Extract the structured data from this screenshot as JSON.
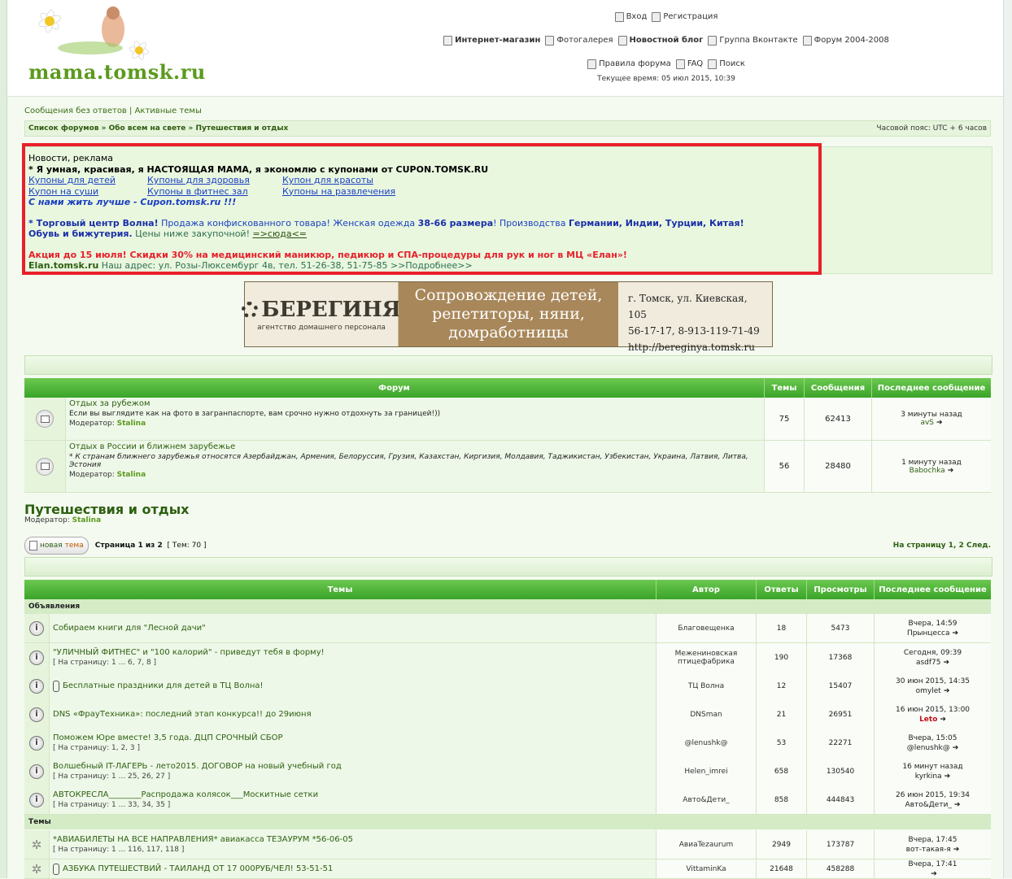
{
  "site": {
    "logo_text": "mama.tomsk.ru"
  },
  "header": {
    "login": "Вход",
    "register": "Регистрация",
    "links": [
      "Интернет-магазин",
      "Фотогалерея",
      "Новостной блог",
      "Группа Вконтакте",
      "Форум 2004-2008"
    ],
    "links2": [
      "Правила форума",
      "FAQ",
      "Поиск"
    ],
    "current_time": "Текущее время: 05 июл 2015, 10:39"
  },
  "toplinks": {
    "unanswered": "Сообщения без ответов",
    "sep": "|",
    "active": "Активные темы"
  },
  "breadcrumb": {
    "text": "Список форумов » Обо всем на свете » Путешествия и отдых",
    "timezone": "Часовой пояс: UTC + 6 часов"
  },
  "ad": {
    "title": "Новости, реклама",
    "line1": "* Я умная, красивая, я НАСТОЯЩАЯ МАМА, я экономлю с купонами от CUPON.TOMSK.RU",
    "links_row1": [
      "Купоны для детей",
      "Купоны для здоровья",
      "Купон для красоты"
    ],
    "links_row2": [
      "Купон на суши",
      "Купоны в фитнес зал",
      "Купоны на развлечения"
    ],
    "slogan": "С нами жить лучше - Cupon.tomsk.ru !!!",
    "volna_a": "* ",
    "volna_b": "Торговый центр Волна!",
    "volna_c": " Продажа конфискованного товара! Женская одежда ",
    "volna_d": "38-66 размера",
    "volna_e": "! Производства ",
    "volna_f": "Германии, Индии, Турции, Китая!",
    "volna2_a": "Обувь и бижутерия.",
    "volna2_b": " Цены ниже закупочной! ",
    "volna2_c": "=>сюда<=",
    "promo": "Акция до 15 июля! Скидки 30% на медицинский маникюр, педикюр и СПА-процедуры для рук и ног в МЦ «Елан»!",
    "elan_a": "Elan.tomsk.ru",
    "elan_b": " Наш адрес: ул. Розы-Люксембург 4в, тел. 51-26-38, 51-75-85 >>Подробнее>>"
  },
  "banner": {
    "brand": "БЕРЕГИНЯ",
    "sub": "агентство домашнего персонала",
    "mid": [
      "Сопровождение детей,",
      "репетиторы, няни,",
      "домработницы"
    ],
    "addr": "г. Томск, ул. Киевская, 105",
    "phones": "56-17-17, 8-913-119-71-49",
    "url": "http://bereginya.tomsk.ru"
  },
  "forums_table": {
    "headers": {
      "forum": "Форум",
      "topics": "Темы",
      "posts": "Сообщения",
      "last": "Последнее сообщение"
    },
    "rows": [
      {
        "title": "Отдых за рубежом",
        "desc": "Если вы выглядите как на фото в загранпаспорте, вам срочно нужно отдохнуть за границей!))",
        "mod_label": "Модератор:",
        "mod": "Stalina",
        "topics": "75",
        "posts": "62413",
        "last_time": "3 минуты назад",
        "last_user": "avS"
      },
      {
        "title": "Отдых в России и ближнем зарубежье",
        "desc": "* К странам ближнего зарубежья относятся Азербайджан, Армения, Белоруссия, Грузия, Казахстан, Киргизия, Молдавия, Таджикистан, Узбекистан, Украина, Латвия, Литва, Эстония",
        "mod_label": "Модератор:",
        "mod": "Stalina",
        "topics": "56",
        "posts": "28480",
        "last_time": "1 минуту назад",
        "last_user": "Babochka"
      }
    ]
  },
  "section": {
    "title": "Путешествия и отдых",
    "mod_label": "Модератор:",
    "mod": "Stalina"
  },
  "pager": {
    "new_topic_a": "новая",
    "new_topic_b": "тема",
    "page_a": "Страница ",
    "page_cur": "1",
    "page_b": " из ",
    "page_total": "2",
    "topics_count": "[ Тем: 70 ]",
    "goto": "На страницу 1, 2  След."
  },
  "topics_table": {
    "headers": {
      "topics": "Темы",
      "author": "Автор",
      "replies": "Ответы",
      "views": "Просмотры",
      "last": "Последнее сообщение"
    },
    "announce_label": "Объявления",
    "topics_label": "Темы",
    "announcements": [
      {
        "title": "Собираем книги для \"Лесной дачи\"",
        "pages": "",
        "author": "Благовещенка",
        "replies": "18",
        "views": "5473",
        "last_time": "Вчера, 14:59",
        "last_user": "Прынцесса",
        "clip": false
      },
      {
        "title": "\"УЛИЧНЫЙ ФИТНЕС\" и \"100 калорий\" - приведут тебя в форму!",
        "pages": "[ На страницу: 1 ... 6, 7, 8 ]",
        "author": "Межениновская птицефабрика",
        "replies": "190",
        "views": "17368",
        "last_time": "Сегодня, 09:39",
        "last_user": "asdf75",
        "clip": false
      },
      {
        "title": "Бесплатные праздники для детей в ТЦ Волна!",
        "pages": "",
        "author": "ТЦ Волна",
        "replies": "12",
        "views": "15407",
        "last_time": "30 июн 2015, 14:35",
        "last_user": "omylet",
        "clip": true
      },
      {
        "title": "DNS «ФрауТехника»: последний этап конкурса!! до 29июня",
        "pages": "",
        "author": "DNSman",
        "replies": "21",
        "views": "26951",
        "last_time": "16 июн 2015, 13:00",
        "last_user": "Leto",
        "clip": false,
        "red_user": true
      },
      {
        "title": "Поможем Юре вместе! 3,5 года. ДЦП СРОЧНЫЙ СБОР",
        "pages": "[ На страницу: 1, 2, 3 ]",
        "author": "@lenushk@",
        "replies": "53",
        "views": "22271",
        "last_time": "Вчера, 15:05",
        "last_user": "@lenushk@",
        "clip": false
      },
      {
        "title": "Волшебный IT-ЛАГЕРЬ - лето2015. ДОГОВОР на новый учебный год",
        "pages": "[ На страницу: 1 ... 25, 26, 27 ]",
        "author": "Helen_imrei",
        "replies": "658",
        "views": "130540",
        "last_time": "16 минут назад",
        "last_user": "kyrkina",
        "clip": false
      },
      {
        "title": "АВТОКРЕСЛА________Распродажа колясок___Москитные сетки",
        "pages": "[ На страницу: 1 ... 33, 34, 35 ]",
        "author": "Авто&Дети_",
        "replies": "858",
        "views": "444843",
        "last_time": "26 июн 2015, 19:34",
        "last_user": "Авто&Дети_",
        "clip": false
      }
    ],
    "topics": [
      {
        "title": "*АВИАБИЛЕТЫ НА ВСЕ НАПРАВЛЕНИЯ* авиакасса ТЕЗАУРУМ *56-06-05",
        "pages": "[ На страницу: 1 ... 116, 117, 118 ]",
        "author": "АвиаTezaurum",
        "replies": "2949",
        "views": "173787",
        "last_time": "Вчера, 17:45",
        "last_user": "вот-такая-я",
        "clip": false
      },
      {
        "title": "АЗБУКА ПУТЕШЕСТВИЙ - ТАИЛАНД ОТ 17 000РУБ/ЧЕЛ! 53-51-51",
        "pages": "",
        "author": "VittaminKa",
        "replies": "21648",
        "views": "458288",
        "last_time": "Вчера, 17:41",
        "last_user": "",
        "clip": true
      }
    ]
  }
}
